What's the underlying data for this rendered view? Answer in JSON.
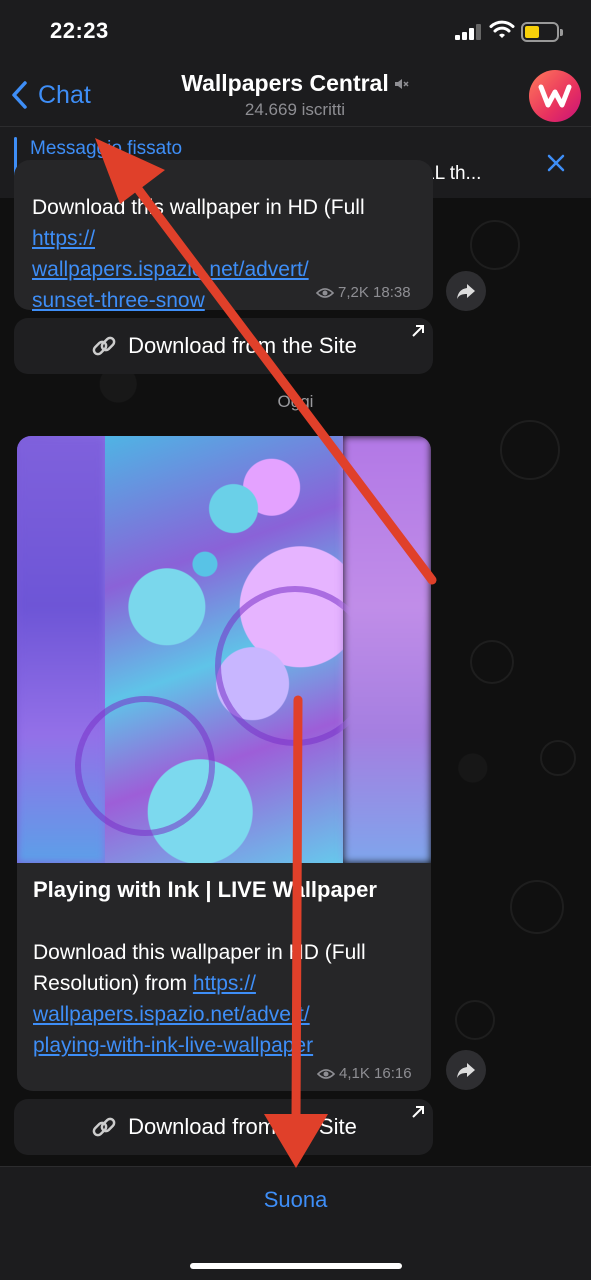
{
  "status_bar": {
    "time": "22:23"
  },
  "header": {
    "back_label": "Chat",
    "title": "Wallpapers Central",
    "subtitle": "24.669 iscritti"
  },
  "pinned": {
    "label": "Messaggio fissato",
    "text": "EXCLUSIVE: We've the Super HD version of ALL th..."
  },
  "message1": {
    "text_partial": "Download this wallpaper in HD (Full Resolution) from ",
    "link": "https://wallpapers.ispazio.net/advert/sunset-three-snow",
    "link_line1": "https://",
    "link_line2": "wallpapers.ispazio.net/advert/",
    "link_line3": "sunset-three-snow",
    "views": "7,2K",
    "time": "18:38",
    "button_label": "Download from the Site"
  },
  "date_separator": "Oggi",
  "message2": {
    "title": "Playing with Ink | LIVE Wallpaper",
    "text_line1": "Download this wallpaper in HD (Full",
    "text_line2": "Resolution) from ",
    "link_line1": "https://",
    "link_line2": "wallpapers.ispazio.net/advert/",
    "link_line3": "playing-with-ink-live-wallpaper",
    "views": "4,1K",
    "time": "16:16",
    "button_label": "Download from the Site"
  },
  "bottom": {
    "action_label": "Suona"
  },
  "colors": {
    "accent": "#3e8ef7",
    "bubble": "#262628",
    "annotation_arrow": "#e0402a",
    "battery": "#f7d00a"
  }
}
